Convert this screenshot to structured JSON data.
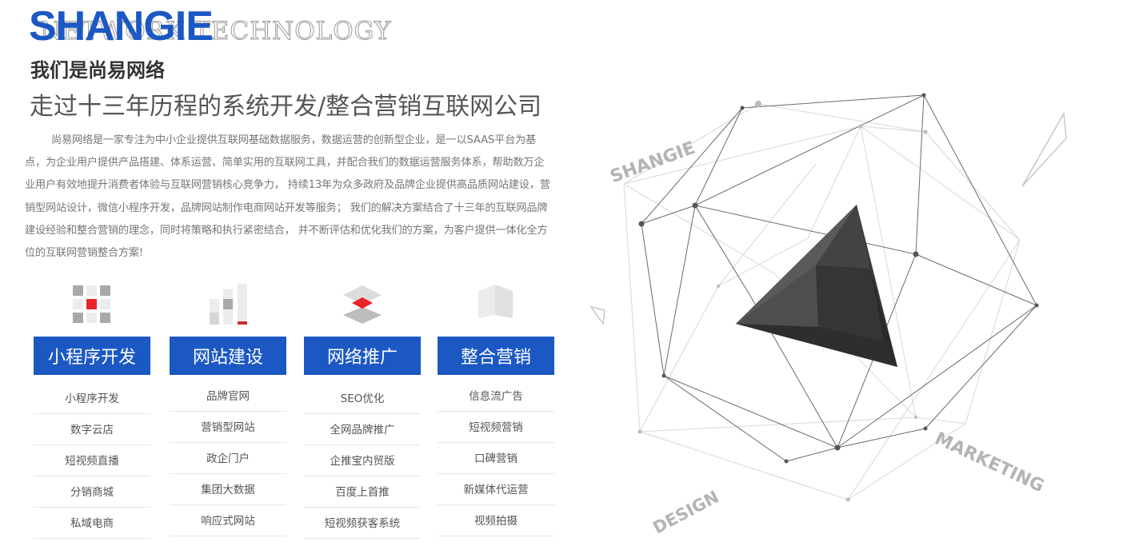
{
  "brand": {
    "logo_text": "SHANGIE",
    "background_text": "NETWORK TECHNOLOGY",
    "accent_color": "#1c58c4"
  },
  "about": {
    "subtitle": "我们是尚易网络",
    "headline": "走过十三年历程的系统开发/整合营销互联网公司",
    "intro": "尚易网络是一家专注为中小企业提供互联网基础数据服务，数据运营的创新型企业，是一以SAAS平台为基点，为企业用户提供产品搭建、体系运营、简单实用的互联网工具，并配合我们的数据运营服务体系，帮助数万企业用户有效地提升消费者体验与互联网营销核心竞争力， 持续13年为众多政府及品牌企业提供高品质网站建设，营销型网站设计，微信小程序开发，品牌网站制作电商网站开发等服务； 我们的解决方案结合了十三年的互联网品牌建设经验和整合营销的理念，同时将策略和执行紧密结合， 并不断评估和优化我们的方案，为客户提供一体化全方位的互联网营销整合方案!"
  },
  "services": [
    {
      "icon": "grid-icon",
      "title": "小程序开发",
      "items": [
        "小程序开发",
        "数字云店",
        "短视频直播",
        "分销商城",
        "私域电商"
      ]
    },
    {
      "icon": "bar-chart-icon",
      "title": "网站建设",
      "items": [
        "品牌官网",
        "营销型网站",
        "政企门户",
        "集团大数据",
        "响应式网站"
      ]
    },
    {
      "icon": "layers-icon",
      "title": "网络推广",
      "items": [
        "SEO优化",
        "全网品牌推广",
        "企推宝内贸版",
        "百度上首推",
        "短视频获客系统"
      ]
    },
    {
      "icon": "open-book-icon",
      "title": "整合营销",
      "items": [
        "信息流广告",
        "短视频营销",
        "口碑营销",
        "新媒体代运营",
        "视频拍摄"
      ]
    }
  ],
  "graphic": {
    "words": [
      "SHANGIE",
      "DESIGN",
      "MARKETING"
    ],
    "colors": {
      "highlight": "#e8232a",
      "pyramid_dark": "#2e2e2e",
      "pyramid_mid": "#4a4a4a",
      "line_dark": "#6a6a6a",
      "line_light": "#dddddd"
    }
  }
}
